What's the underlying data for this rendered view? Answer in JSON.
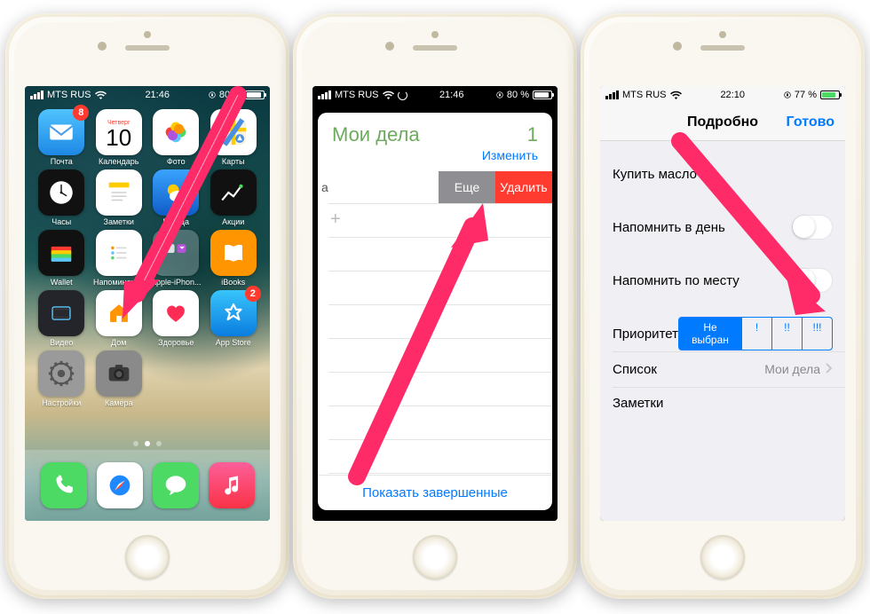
{
  "status": {
    "carrier": "MTS RUS",
    "time_p1": "21:46",
    "time_p2": "21:46",
    "time_p3": "22:10",
    "battery_p1": "80 %",
    "battery_p2": "80 %",
    "battery_p3": "77 %"
  },
  "phone1": {
    "apps": [
      {
        "label": "Почта",
        "badge": "8",
        "bg": "linear-gradient(#4fc3ff,#1e88e5)",
        "svg": "mail"
      },
      {
        "label": "Календарь",
        "bg": "#fff",
        "svg": "calendar",
        "day_name": "Четверг",
        "day_num": "10"
      },
      {
        "label": "Фото",
        "bg": "#fff",
        "svg": "photos"
      },
      {
        "label": "Карты",
        "bg": "#fff",
        "svg": "maps"
      },
      {
        "label": "Часы",
        "bg": "#111",
        "svg": "clock"
      },
      {
        "label": "Заметки",
        "bg": "#fff",
        "svg": "notes"
      },
      {
        "label": "Погода",
        "bg": "linear-gradient(#3aa3ff,#0f5cc7)",
        "svg": "weather"
      },
      {
        "label": "Акции",
        "bg": "#111",
        "svg": "stocks"
      },
      {
        "label": "Wallet",
        "bg": "#111",
        "svg": "wallet"
      },
      {
        "label": "Напоминания",
        "bg": "#fff",
        "svg": "reminders"
      },
      {
        "label": "Apple-iPhon...",
        "bg": "rgba(255,255,255,.25)",
        "svg": "folder"
      },
      {
        "label": "iBooks",
        "bg": "#ff9500",
        "svg": "ibooks"
      },
      {
        "label": "Видео",
        "bg": "#24252a",
        "svg": "video"
      },
      {
        "label": "Дом",
        "bg": "#fff",
        "svg": "home"
      },
      {
        "label": "Здоровье",
        "bg": "#fff",
        "svg": "health"
      },
      {
        "label": "App Store",
        "badge": "2",
        "bg": "linear-gradient(#38c4fb,#0a7de0)",
        "svg": "appstore"
      },
      {
        "label": "Настройки",
        "bg": "#9a9a9a",
        "svg": "settings"
      },
      {
        "label": "Камера",
        "bg": "#8a8a8a",
        "svg": "camera"
      }
    ],
    "dock": [
      {
        "bg": "#4cd964",
        "svg": "phone"
      },
      {
        "bg": "#fff",
        "svg": "safari"
      },
      {
        "bg": "#4cd964",
        "svg": "messages"
      },
      {
        "bg": "linear-gradient(#fc5f9a,#fa3246)",
        "svg": "music"
      }
    ]
  },
  "phone2": {
    "list_title": "Мои дела",
    "list_count": "1",
    "edit": "Изменить",
    "more": "Eще",
    "delete": "Удалить",
    "show_completed": "Показать завершенные"
  },
  "phone3": {
    "title": "Подробно",
    "done": "Готово",
    "item_name": "Купить масло",
    "remind_day": "Напомнить в день",
    "remind_loc": "Напомнить по месту",
    "priority_label": "Приоритет",
    "priority_opts": [
      "Не выбран",
      "!",
      "!!",
      "!!!"
    ],
    "list_label": "Список",
    "list_value": "Мои дела",
    "notes": "Заметки"
  }
}
